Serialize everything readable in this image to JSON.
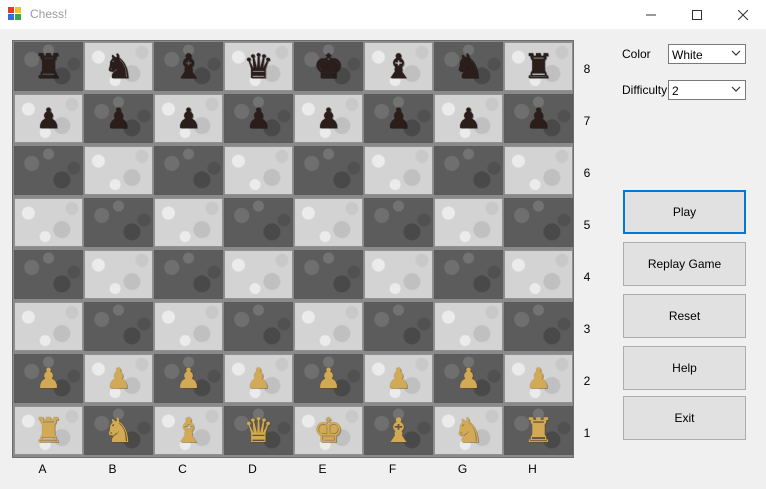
{
  "window": {
    "title": "Chess!",
    "icon": "chessboard-app-icon",
    "controls": [
      "minimize-icon",
      "maximize-icon",
      "close-icon"
    ]
  },
  "board": {
    "files": [
      "A",
      "B",
      "C",
      "D",
      "E",
      "F",
      "G",
      "H"
    ],
    "ranks": [
      "8",
      "7",
      "6",
      "5",
      "4",
      "3",
      "2",
      "1"
    ],
    "rows": [
      [
        "black-rook",
        "black-knight",
        "black-bishop",
        "black-queen",
        "black-king",
        "black-bishop",
        "black-knight",
        "black-rook"
      ],
      [
        "black-pawn",
        "black-pawn",
        "black-pawn",
        "black-pawn",
        "black-pawn",
        "black-pawn",
        "black-pawn",
        "black-pawn"
      ],
      [
        "",
        "",
        "",
        "",
        "",
        "",
        "",
        ""
      ],
      [
        "",
        "",
        "",
        "",
        "",
        "",
        "",
        ""
      ],
      [
        "",
        "",
        "",
        "",
        "",
        "",
        "",
        ""
      ],
      [
        "",
        "",
        "",
        "",
        "",
        "",
        "",
        ""
      ],
      [
        "white-pawn",
        "white-pawn",
        "white-pawn",
        "white-pawn",
        "white-pawn",
        "white-pawn",
        "white-pawn",
        "white-pawn"
      ],
      [
        "white-rook",
        "white-knight",
        "white-bishop",
        "white-queen",
        "white-king",
        "white-bishop",
        "white-knight",
        "white-rook"
      ]
    ],
    "colors": {
      "light_square": "#d3d3d3",
      "dark_square": "#5c5c5c",
      "black_piece": "#2a1d1a",
      "white_piece": "#d2aa55"
    }
  },
  "settings": {
    "color_label": "Color",
    "color_value": "White",
    "difficulty_label": "Difficulty",
    "difficulty_value": "2"
  },
  "buttons": {
    "play": "Play",
    "replay": "Replay Game",
    "reset": "Reset",
    "help": "Help",
    "exit": "Exit"
  },
  "accent_color": "#0078d7"
}
